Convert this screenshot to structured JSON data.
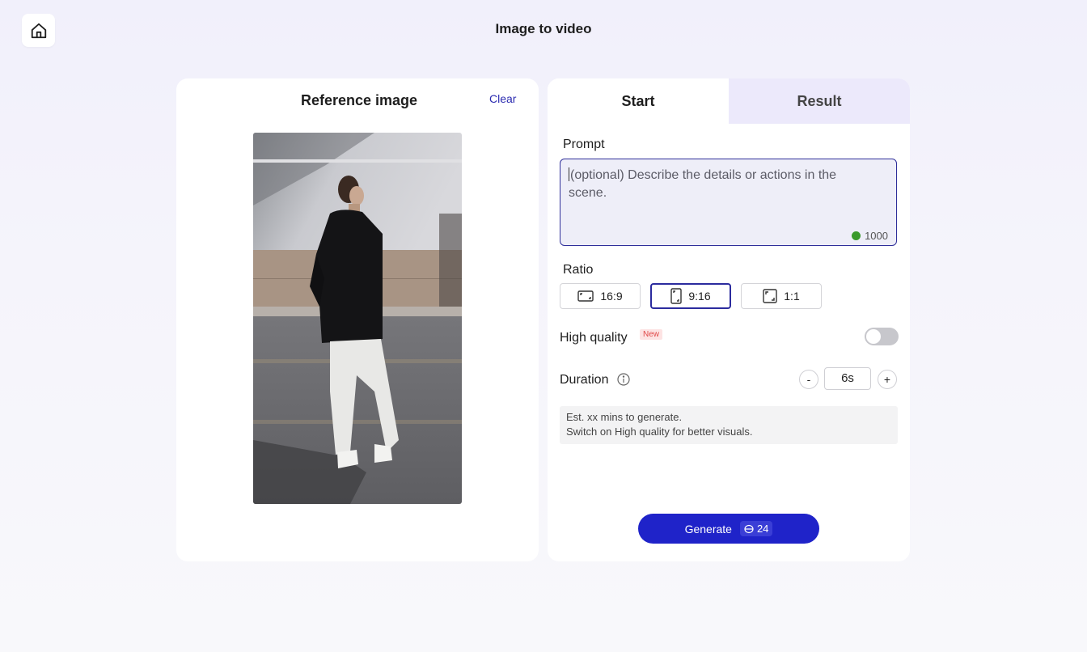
{
  "page": {
    "title": "Image to video"
  },
  "reference": {
    "title": "Reference image",
    "clear_label": "Clear"
  },
  "tabs": [
    {
      "label": "Start",
      "active": true
    },
    {
      "label": "Result",
      "active": false
    }
  ],
  "prompt": {
    "label": "Prompt",
    "placeholder": "(optional) Describe the details or actions in the scene.",
    "char_limit": "1000"
  },
  "ratio": {
    "label": "Ratio",
    "options": [
      {
        "label": "16:9",
        "icon": "landscape-icon",
        "selected": false
      },
      {
        "label": "9:16",
        "icon": "portrait-icon",
        "selected": true
      },
      {
        "label": "1:1",
        "icon": "square-icon",
        "selected": false
      }
    ]
  },
  "high_quality": {
    "label": "High quality",
    "badge": "New",
    "enabled": false
  },
  "duration": {
    "label": "Duration",
    "value": "6s",
    "decrement_label": "-",
    "increment_label": "+"
  },
  "estimate": {
    "line1": "Est. xx mins to generate.",
    "line2": "Switch on High quality for better visuals."
  },
  "generate": {
    "label": "Generate",
    "cost": "24"
  },
  "colors": {
    "accent": "#1f23c9",
    "active_border": "#2b2b9e",
    "result_tab": "#ece9fb",
    "badge_bg": "#fde3e3",
    "badge_text": "#e04848",
    "counter_dot": "#3a9a2c"
  }
}
